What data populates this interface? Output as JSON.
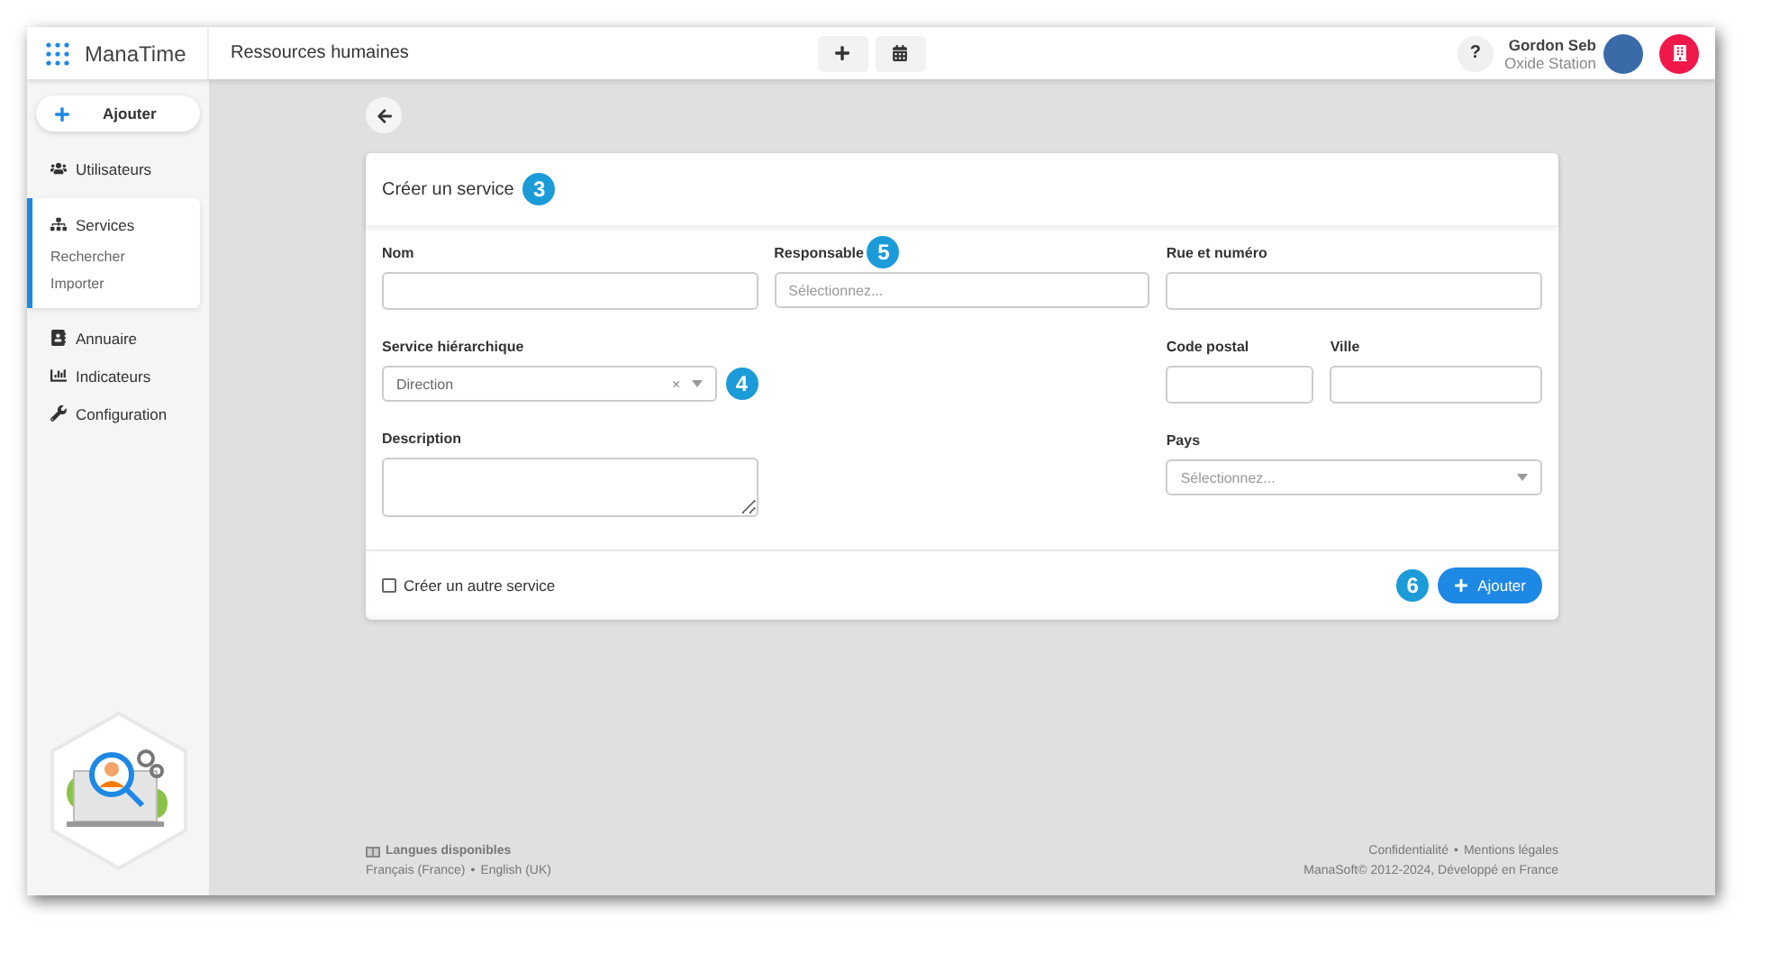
{
  "topbar": {
    "app_name": "ManaTime",
    "section": "Ressources humaines",
    "help": "?",
    "user": {
      "name": "Gordon Seb",
      "company": "Oxide Station"
    }
  },
  "sidebar": {
    "add_button": "Ajouter",
    "items": [
      {
        "label": "Utilisateurs",
        "selected": false
      },
      {
        "label": "Services",
        "selected": true,
        "children": [
          {
            "label": "Rechercher"
          },
          {
            "label": "Importer"
          }
        ]
      },
      {
        "label": "Annuaire",
        "selected": false
      },
      {
        "label": "Indicateurs",
        "selected": false
      },
      {
        "label": "Configuration",
        "selected": false
      }
    ]
  },
  "form": {
    "title": "Créer un service",
    "title_badge": "3",
    "columns": [
      [
        [
          {
            "label": "Nom",
            "kind": "input"
          }
        ],
        [
          {
            "label": "Service hiérarchique",
            "kind": "select",
            "value": "Direction",
            "clear": "×",
            "caret": true,
            "control_badge": "4"
          }
        ],
        [
          {
            "label": "Description",
            "kind": "textarea"
          }
        ]
      ],
      [
        [
          {
            "label": "Responsable",
            "kind": "select",
            "placeholder": "Sélectionnez...",
            "caret": false,
            "label_badge": "5"
          }
        ]
      ],
      [
        [
          {
            "label": "Rue et numéro",
            "kind": "input"
          }
        ],
        [
          {
            "label": "Code postal",
            "kind": "input"
          },
          {
            "label": "Ville",
            "kind": "input"
          }
        ],
        [
          {
            "label": "Pays",
            "kind": "select",
            "placeholder": "Sélectionnez...",
            "caret": true
          }
        ]
      ]
    ],
    "another": {
      "label": "Créer un autre service",
      "checked": false
    },
    "submit": "Ajouter",
    "submit_badge": "6"
  },
  "footer": {
    "languages_title": "Langues disponibles",
    "languages": [
      "Français (France)",
      "•",
      "English (UK)"
    ],
    "links": [
      "Confidentialité",
      "•",
      "Mentions légales"
    ],
    "copyright": "ManaSoft© 2012-2024, Développé en France"
  }
}
